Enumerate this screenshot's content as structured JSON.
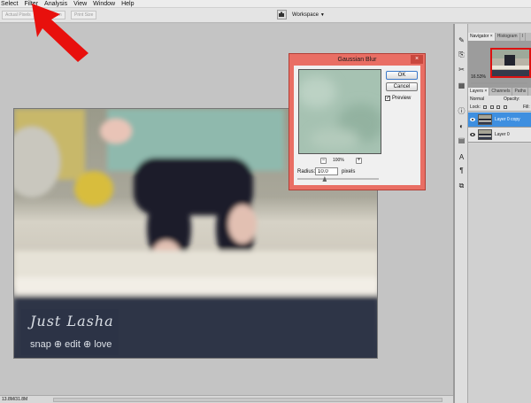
{
  "menu": {
    "items": [
      "Select",
      "Filter",
      "Analysis",
      "View",
      "Window",
      "Help"
    ]
  },
  "options_bar": {
    "actual_pixels": "Actual Pixels",
    "fill_screen": "Fill Screen",
    "print_size": "Print Size",
    "workspace": "Workspace"
  },
  "image": {
    "watermark_script": "Just Lasha",
    "watermark_tagline": "snap ⊕ edit ⊕ love"
  },
  "status": {
    "doc_size": "13.8M/31.8M"
  },
  "navigator": {
    "tabs": [
      "Navigator ×",
      "Histogram",
      "I"
    ],
    "zoom": "16.53%"
  },
  "layers": {
    "tabs": [
      "Layers ×",
      "Channels",
      "Paths"
    ],
    "blend_mode": "Normal",
    "opacity_label": "Opacity:",
    "lock_label": "Lock:",
    "fill_label": "Fill:",
    "rows": [
      {
        "name": "Layer 0 copy",
        "selected": true
      },
      {
        "name": "Layer 0",
        "selected": false
      }
    ]
  },
  "dialog": {
    "title": "Gaussian Blur",
    "close": "×",
    "ok": "OK",
    "cancel": "Cancel",
    "preview_label": "Preview",
    "preview_checked": true,
    "zoom_minus": "−",
    "zoom_plus": "+",
    "zoom_pct": "100%",
    "radius_label": "Radius:",
    "radius_value": "10.0",
    "radius_unit": "pixels",
    "radius_slider_fraction": 0.33
  },
  "colors": {
    "dialog_frame": "#e96e64",
    "selected_layer": "#3e8fe0",
    "arrow": "#e8100d"
  }
}
